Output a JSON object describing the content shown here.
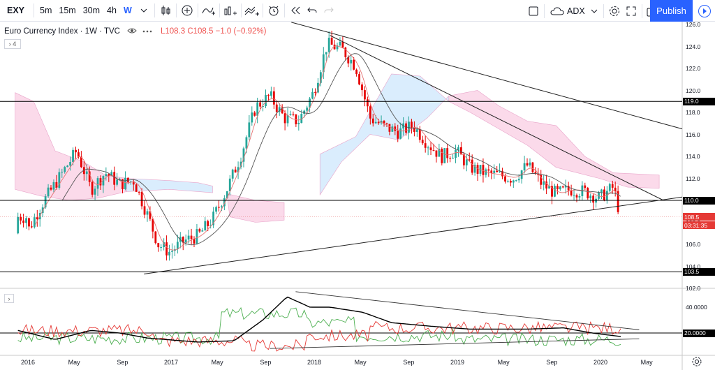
{
  "toolbar": {
    "symbol": "EXY",
    "intervals": [
      "5m",
      "15m",
      "30m",
      "4h",
      "W"
    ],
    "active_interval": "W",
    "indicator_label": "ADX",
    "publish_label": "Publish"
  },
  "legend": {
    "title": "Euro Currency Index · 1W · TVC",
    "ohlc": "L108.3 C108.5 −1.0 (−0.92%)",
    "collapse_count": "4"
  },
  "price_axis": {
    "ticks": [
      "126.0",
      "124.0",
      "122.0",
      "120.0",
      "118.0",
      "116.0",
      "114.0",
      "112.0",
      "110.0",
      "108.0",
      "106.0",
      "104.0",
      "102.0"
    ],
    "tags": [
      {
        "label": "119.0",
        "color": "#000000"
      },
      {
        "label": "110.0",
        "color": "#000000"
      },
      {
        "label": "108.5",
        "color": "#e53935"
      },
      {
        "label": "03:31:35",
        "color": "#e53935"
      },
      {
        "label": "103.5",
        "color": "#000000"
      }
    ]
  },
  "indicator_axis": {
    "ticks": [
      "40.0000"
    ],
    "tag": "20.0000"
  },
  "time_axis": {
    "labels": [
      "2016",
      "May",
      "Sep",
      "2017",
      "May",
      "Sep",
      "2018",
      "May",
      "Sep",
      "2019",
      "May",
      "Sep",
      "2020",
      "May"
    ]
  },
  "colors": {
    "bull": "#26a69a",
    "bear": "#e60000",
    "cloud_bear": "#f8bbd9",
    "cloud_bull": "#bbdefb",
    "adx": "#000000",
    "di_plus": "#4caf50",
    "di_minus": "#e53935"
  },
  "chart_data": {
    "type": "candlestick",
    "title": "Euro Currency Index · 1W · TVC",
    "ylim": [
      102,
      126
    ],
    "series_close": [
      [
        2016.0,
        107.0
      ],
      [
        2016.1,
        109.5
      ],
      [
        2016.25,
        112.5
      ],
      [
        2016.35,
        114.5
      ],
      [
        2016.45,
        111.0
      ],
      [
        2016.55,
        112.5
      ],
      [
        2016.65,
        111.5
      ],
      [
        2016.75,
        111.8
      ],
      [
        2016.85,
        108.5
      ],
      [
        2016.92,
        106.0
      ],
      [
        2017.0,
        105.3
      ],
      [
        2017.1,
        106.3
      ],
      [
        2017.2,
        106.8
      ],
      [
        2017.3,
        108.3
      ],
      [
        2017.4,
        111.0
      ],
      [
        2017.5,
        114.2
      ],
      [
        2017.6,
        118.5
      ],
      [
        2017.7,
        119.5
      ],
      [
        2017.8,
        117.5
      ],
      [
        2017.9,
        117.2
      ],
      [
        2018.0,
        119.7
      ],
      [
        2018.1,
        124.2
      ],
      [
        2018.2,
        123.8
      ],
      [
        2018.3,
        122.2
      ],
      [
        2018.4,
        117.5
      ],
      [
        2018.5,
        116.7
      ],
      [
        2018.6,
        116.2
      ],
      [
        2018.7,
        116.8
      ],
      [
        2018.8,
        115.2
      ],
      [
        2018.9,
        114.0
      ],
      [
        2019.0,
        114.5
      ],
      [
        2019.1,
        113.0
      ],
      [
        2019.2,
        112.5
      ],
      [
        2019.3,
        112.3
      ],
      [
        2019.4,
        112.0
      ],
      [
        2019.5,
        113.2
      ],
      [
        2019.6,
        111.5
      ],
      [
        2019.7,
        110.6
      ],
      [
        2019.8,
        111.0
      ],
      [
        2019.9,
        110.8
      ],
      [
        2020.0,
        110.2
      ],
      [
        2020.1,
        111.2
      ],
      [
        2020.15,
        108.5
      ]
    ],
    "adx_trendlines": true
  }
}
